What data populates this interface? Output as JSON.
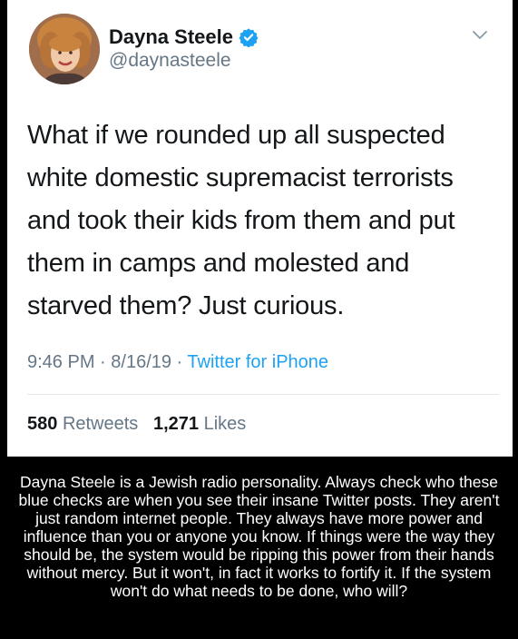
{
  "tweet": {
    "display_name": "Dayna Steele",
    "handle": "@daynasteele",
    "text_lines": [
      "What if we rounded up all suspected",
      "white domestic supremacist terrorists",
      "and took their kids from them and put",
      "them in camps and molested and",
      "starved them? Just curious."
    ],
    "time": "9:46 PM",
    "date": "8/16/19",
    "separator": " · ",
    "source": "Twitter for iPhone",
    "retweets_count": "580",
    "retweets_label": "Retweets",
    "likes_count": "1,271",
    "likes_label": "Likes"
  },
  "caption": {
    "text": "Dayna Steele is a Jewish radio personality. Always check who these blue checks are when you see their insane Twitter posts. They aren't just random internet people. They always have more power and influence than you or anyone you know. If things were the way they should be, the system would be ripping this power from their hands without mercy. But it won't, in fact it works to fortify it. If the system won't do what needs to be done, who will?"
  },
  "colors": {
    "verified": "#1da1f2",
    "link": "#1da1f2",
    "secondary_text": "#657786",
    "primary_text": "#14171a"
  },
  "icons": {
    "verified": "verified-badge-icon",
    "menu": "chevron-down-icon"
  }
}
